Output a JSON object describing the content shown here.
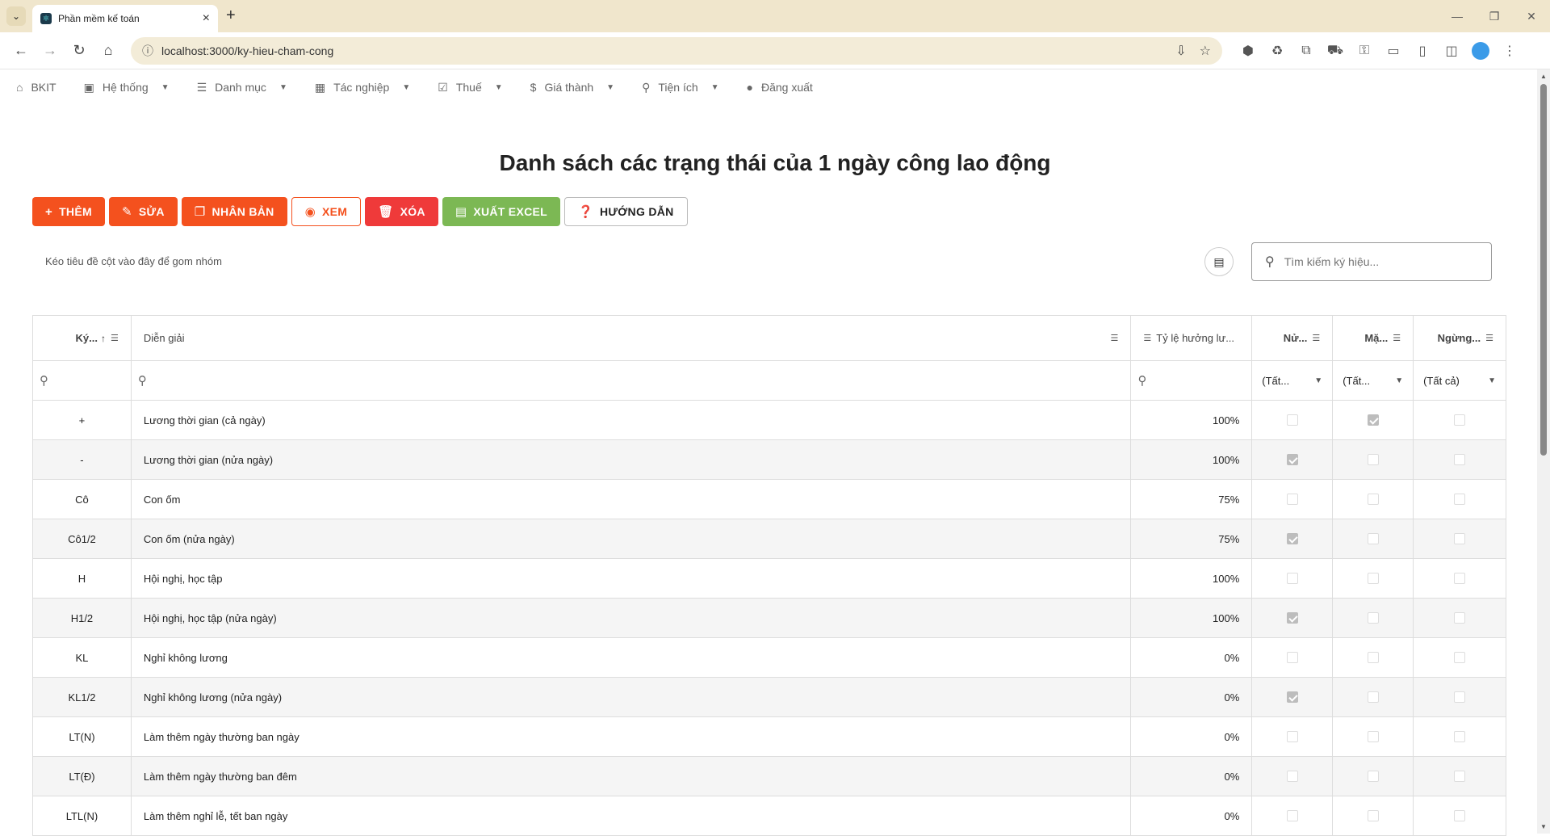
{
  "browser": {
    "tab_title": "Phần mềm kế toán",
    "url": "localhost:3000/ky-hieu-cham-cong"
  },
  "appnav": {
    "items": [
      {
        "label": "BKIT",
        "icon": "home-icon",
        "has_dropdown": false
      },
      {
        "label": "Hệ thống",
        "icon": "save-icon",
        "has_dropdown": true
      },
      {
        "label": "Danh mục",
        "icon": "list-icon",
        "has_dropdown": true
      },
      {
        "label": "Tác nghiệp",
        "icon": "table-icon",
        "has_dropdown": true
      },
      {
        "label": "Thuế",
        "icon": "checklist-icon",
        "has_dropdown": true
      },
      {
        "label": "Giá thành",
        "icon": "dollar-icon",
        "has_dropdown": true
      },
      {
        "label": "Tiện ích",
        "icon": "run-icon",
        "has_dropdown": true
      },
      {
        "label": "Đăng xuất",
        "icon": "circle-icon",
        "has_dropdown": false
      }
    ]
  },
  "page": {
    "title": "Danh sách các trạng thái của 1 ngày công lao động"
  },
  "actions": {
    "add": "THÊM",
    "edit": "SỬA",
    "duplicate": "NHÂN BẢN",
    "view": "XEM",
    "delete": "XÓA",
    "export": "XUẤT EXCEL",
    "guide": "HƯỚNG DẪN"
  },
  "grid": {
    "group_hint": "Kéo tiêu đề cột vào đây để gom nhóm",
    "search_placeholder": "Tìm kiếm ký hiệu...",
    "columns": {
      "symbol": "Ký...",
      "description": "Diễn giải",
      "rate": "Tỷ lệ hưởng lư...",
      "half": "Nử...",
      "default": "Mặ...",
      "inactive": "Ngừng..."
    },
    "filter_all": {
      "half": "(Tất...",
      "default": "(Tất...",
      "inactive": "(Tất cả)"
    },
    "rows": [
      {
        "symbol": "+",
        "description": "Lương thời gian (cả ngày)",
        "rate": "100%",
        "half": false,
        "default": true,
        "inactive": false
      },
      {
        "symbol": "-",
        "description": "Lương thời gian (nửa ngày)",
        "rate": "100%",
        "half": true,
        "default": false,
        "inactive": false
      },
      {
        "symbol": "Cô",
        "description": "Con ốm",
        "rate": "75%",
        "half": false,
        "default": false,
        "inactive": false
      },
      {
        "symbol": "Cô1/2",
        "description": "Con ốm (nửa ngày)",
        "rate": "75%",
        "half": true,
        "default": false,
        "inactive": false
      },
      {
        "symbol": "H",
        "description": "Hội nghị, học tập",
        "rate": "100%",
        "half": false,
        "default": false,
        "inactive": false
      },
      {
        "symbol": "H1/2",
        "description": "Hội nghị, học tập (nửa ngày)",
        "rate": "100%",
        "half": true,
        "default": false,
        "inactive": false
      },
      {
        "symbol": "KL",
        "description": "Nghỉ không lương",
        "rate": "0%",
        "half": false,
        "default": false,
        "inactive": false
      },
      {
        "symbol": "KL1/2",
        "description": "Nghỉ không lương (nửa ngày)",
        "rate": "0%",
        "half": true,
        "default": false,
        "inactive": false
      },
      {
        "symbol": "LT(N)",
        "description": "Làm thêm ngày thường ban ngày",
        "rate": "0%",
        "half": false,
        "default": false,
        "inactive": false
      },
      {
        "symbol": "LT(Đ)",
        "description": "Làm thêm ngày thường ban đêm",
        "rate": "0%",
        "half": false,
        "default": false,
        "inactive": false
      },
      {
        "symbol": "LTL(N)",
        "description": "Làm thêm nghỉ lễ, tết ban ngày",
        "rate": "0%",
        "half": false,
        "default": false,
        "inactive": false
      }
    ]
  }
}
